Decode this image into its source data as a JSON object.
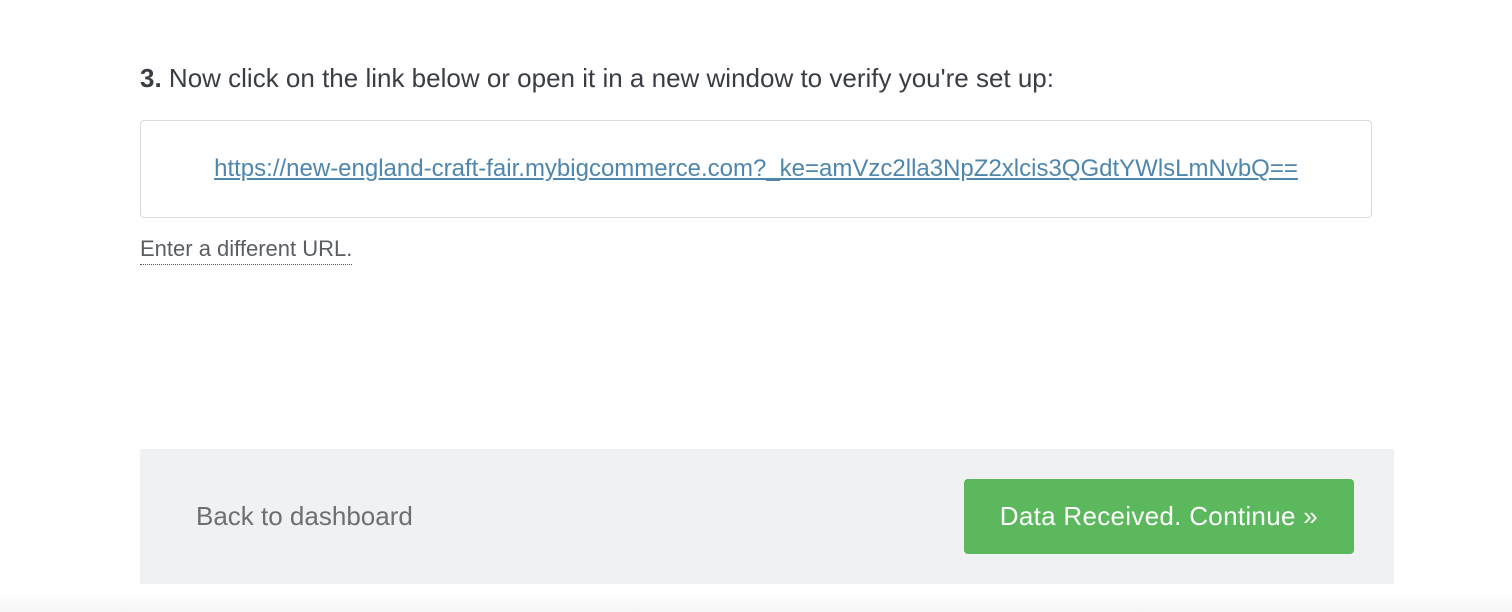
{
  "step": {
    "number": "3.",
    "instruction": "Now click on the link below or open it in a new window to verify you're set up:"
  },
  "verification": {
    "url": "https://new-england-craft-fair.mybigcommerce.com?_ke=amVzc2lla3NpZ2xlcis3QGdtYWlsLmNvbQ=="
  },
  "links": {
    "different_url": "Enter a different URL."
  },
  "footer": {
    "back_label": "Back to dashboard",
    "continue_label": "Data Received. Continue »"
  }
}
